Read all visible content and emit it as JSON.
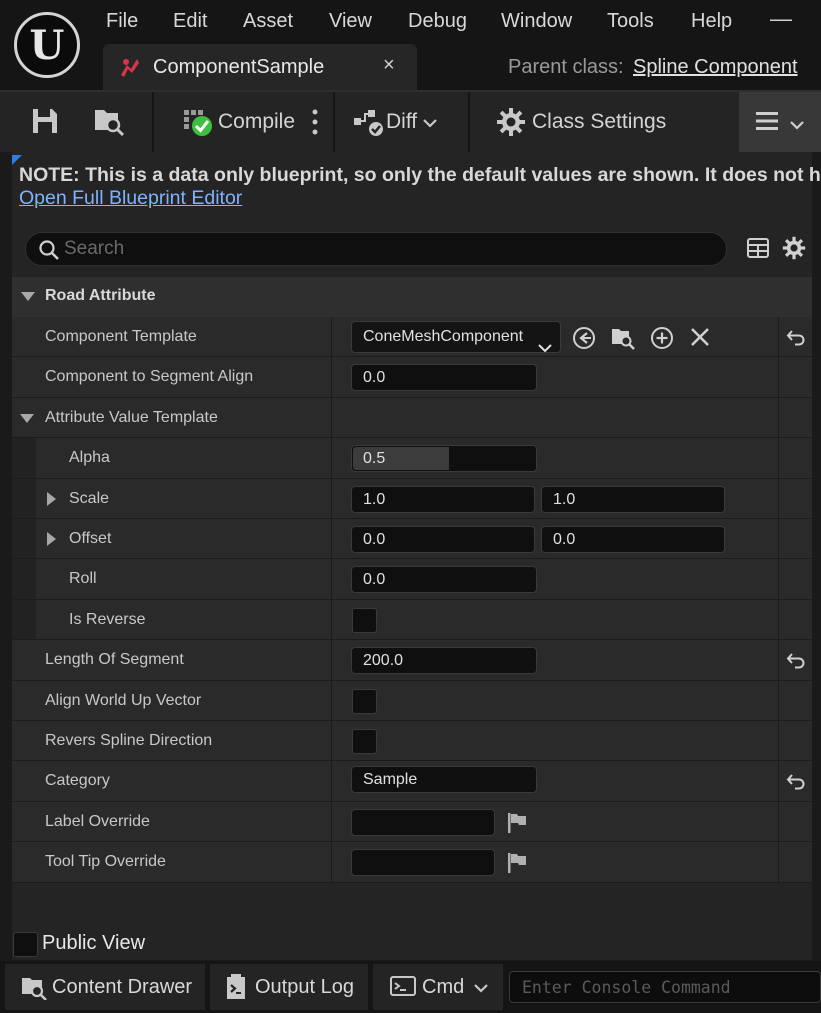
{
  "app": {
    "menu": [
      "File",
      "Edit",
      "Asset",
      "View",
      "Debug",
      "Window",
      "Tools",
      "Help"
    ],
    "minimize_glyph": "—",
    "tab": {
      "title": "ComponentSample",
      "close_glyph": "×"
    },
    "parent_class_label": "Parent class:",
    "parent_class_value": "Spline Component"
  },
  "toolbar": {
    "compile_label": "Compile",
    "diff_label": "Diff",
    "class_settings_label": "Class Settings"
  },
  "details": {
    "note_text": "NOTE: This is a data only blueprint, so only the default values are shown.  It does not have",
    "note_link": "Open Full Blueprint Editor",
    "search_placeholder": "Search",
    "category": "Road Attribute",
    "properties": {
      "component_template": {
        "label": "Component Template",
        "value": "ConeMeshComponent"
      },
      "segment_align": {
        "label": "Component to Segment Align",
        "value": "0.0"
      },
      "attribute_value_template": {
        "label": "Attribute Value Template"
      },
      "alpha": {
        "label": "Alpha",
        "value": "0.5",
        "fill": 0.5
      },
      "scale": {
        "label": "Scale",
        "x": "1.0",
        "y": "1.0"
      },
      "offset": {
        "label": "Offset",
        "x": "0.0",
        "y": "0.0"
      },
      "roll": {
        "label": "Roll",
        "value": "0.0"
      },
      "is_reverse": {
        "label": "Is Reverse",
        "checked": false
      },
      "length_of_segment": {
        "label": "Length Of Segment",
        "value": "200.0"
      },
      "align_world_up": {
        "label": "Align World Up Vector",
        "checked": false
      },
      "revers_spline": {
        "label": "Revers Spline Direction",
        "checked": false
      },
      "category": {
        "label": "Category",
        "value": "Sample"
      },
      "label_override": {
        "label": "Label Override",
        "value": ""
      },
      "tooltip_override": {
        "label": "Tool Tip Override",
        "value": ""
      }
    },
    "public_view_label": "Public View"
  },
  "statusbar": {
    "content_drawer": "Content Drawer",
    "output_log": "Output Log",
    "cmd": "Cmd",
    "console_placeholder": "Enter Console Command"
  },
  "colors": {
    "link": "#7fb2ff",
    "compile_ok": "#3fbf3f",
    "tab_icon": "#d8344a"
  }
}
